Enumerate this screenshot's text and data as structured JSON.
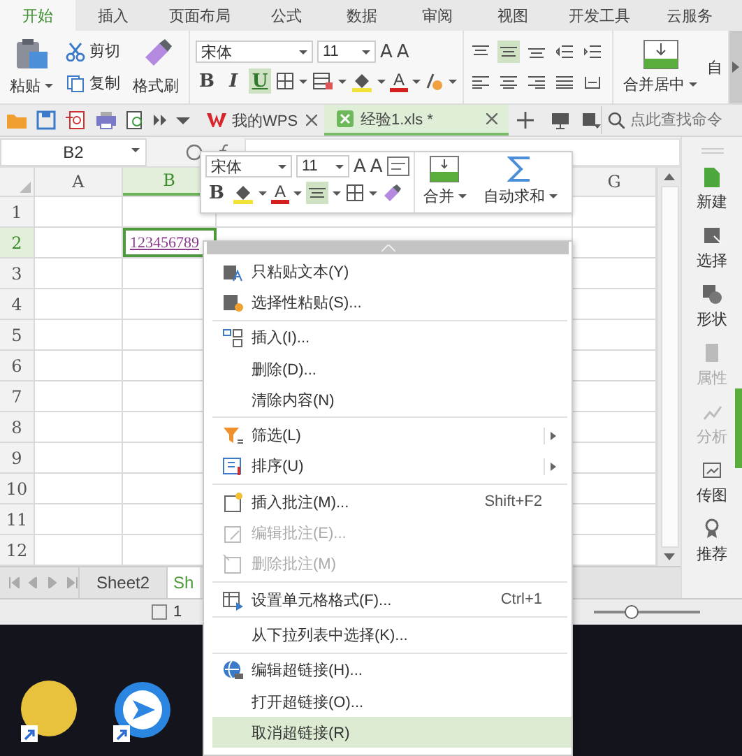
{
  "ribbon_tabs": [
    {
      "label": "开始",
      "selected": true
    },
    {
      "label": "插入",
      "selected": false
    },
    {
      "label": "页面布局",
      "selected": false
    },
    {
      "label": "公式",
      "selected": false
    },
    {
      "label": "数据",
      "selected": false
    },
    {
      "label": "审阅",
      "selected": false
    },
    {
      "label": "视图",
      "selected": false
    },
    {
      "label": "开发工具",
      "selected": false
    },
    {
      "label": "云服务",
      "selected": false
    }
  ],
  "ribbon": {
    "paste": "粘贴",
    "cut": "剪切",
    "copy": "复制",
    "format_painter": "格式刷",
    "font": "宋体",
    "size": "11",
    "grow_font": "A",
    "shrink_font": "A",
    "font_color": "A",
    "format_buttons": [
      {
        "label": "B",
        "on": false
      },
      {
        "label": "I",
        "on": false
      },
      {
        "label": "U",
        "on": true
      }
    ],
    "align_buttons": [
      {
        "on": false
      },
      {
        "on": true
      },
      {
        "on": false
      },
      {
        "on": false
      },
      {
        "on": false
      },
      {
        "on": false
      },
      {
        "on": false
      },
      {
        "on": false
      },
      {
        "on": false
      },
      {
        "on": false
      }
    ],
    "merge": "合并居中",
    "cut_off": "自"
  },
  "doc_tabs": [
    {
      "label": "我的WPS",
      "selected": false
    },
    {
      "label": "经验1.xls *",
      "selected": true
    }
  ],
  "search": {
    "placeholder": "点此查找命令"
  },
  "name_box": "B2",
  "columns": [
    {
      "label": "A",
      "selected": false
    },
    {
      "label": "B",
      "selected": true
    },
    {
      "label": "G",
      "selected": false
    }
  ],
  "rows": [
    {
      "label": "1",
      "selected": false,
      "cells": []
    },
    {
      "label": "2",
      "selected": true,
      "cells": [
        null,
        {
          "value": "123456789",
          "kind": "link",
          "selected": true
        }
      ]
    },
    {
      "label": "3",
      "selected": false,
      "cells": []
    },
    {
      "label": "4",
      "selected": false,
      "cells": []
    },
    {
      "label": "5",
      "selected": false,
      "cells": []
    },
    {
      "label": "6",
      "selected": false,
      "cells": []
    },
    {
      "label": "7",
      "selected": false,
      "cells": []
    },
    {
      "label": "8",
      "selected": false,
      "cells": []
    },
    {
      "label": "9",
      "selected": false,
      "cells": []
    },
    {
      "label": "10",
      "selected": false,
      "cells": []
    },
    {
      "label": "11",
      "selected": false,
      "cells": []
    },
    {
      "label": "12",
      "selected": false,
      "cells": []
    }
  ],
  "mini_toolbar": {
    "font": "宋体",
    "size": "11",
    "grow_font": "A",
    "shrink_font": "A",
    "bold": "B",
    "font_color": "A",
    "align": {
      "on": true
    },
    "merge": "合并",
    "autosum": "自动求和"
  },
  "context_menu": {
    "groups": [
      {
        "items": [
          {
            "label": "只粘贴文本(Y)",
            "disabled": false,
            "selected": false
          },
          {
            "label": "选择性粘贴(S)...",
            "disabled": false,
            "selected": false
          }
        ]
      },
      {
        "items": [
          {
            "label": "插入(I)...",
            "disabled": false,
            "selected": false
          },
          {
            "label": "删除(D)...",
            "disabled": false,
            "selected": false
          },
          {
            "label": "清除内容(N)",
            "disabled": false,
            "selected": false
          }
        ]
      },
      {
        "items": [
          {
            "label": "筛选(L)",
            "submenu": true,
            "disabled": false,
            "selected": false
          },
          {
            "label": "排序(U)",
            "submenu": true,
            "disabled": false,
            "selected": false
          }
        ]
      },
      {
        "items": [
          {
            "label": "插入批注(M)...",
            "shortcut": "Shift+F2",
            "disabled": false,
            "selected": false
          },
          {
            "label": "编辑批注(E)...",
            "disabled": true,
            "selected": false
          },
          {
            "label": "删除批注(M)",
            "disabled": true,
            "selected": false
          }
        ]
      },
      {
        "items": [
          {
            "label": "设置单元格格式(F)...",
            "shortcut": "Ctrl+1",
            "disabled": false,
            "selected": false
          }
        ]
      },
      {
        "items": [
          {
            "label": "从下拉列表中选择(K)...",
            "disabled": false,
            "selected": false
          }
        ]
      },
      {
        "items": [
          {
            "label": "编辑超链接(H)...",
            "disabled": false,
            "selected": false
          },
          {
            "label": "打开超链接(O)...",
            "disabled": false,
            "selected": false
          },
          {
            "label": "取消超链接(R)",
            "disabled": false,
            "selected": true
          }
        ]
      }
    ]
  },
  "sheet_tabs": [
    {
      "label": "Sheet2",
      "selected": false
    },
    {
      "label": "Sh",
      "selected": true
    }
  ],
  "status_bar": {
    "text": "1",
    "zoom": {
      "level": 0.35
    }
  },
  "sidebar": [
    {
      "label": "新建",
      "disabled": false
    },
    {
      "label": "选择",
      "disabled": false
    },
    {
      "label": "形状",
      "disabled": false
    },
    {
      "label": "属性",
      "disabled": true
    },
    {
      "label": "分析",
      "disabled": true
    },
    {
      "label": "传图",
      "disabled": false
    },
    {
      "label": "推荐",
      "disabled": false
    }
  ]
}
